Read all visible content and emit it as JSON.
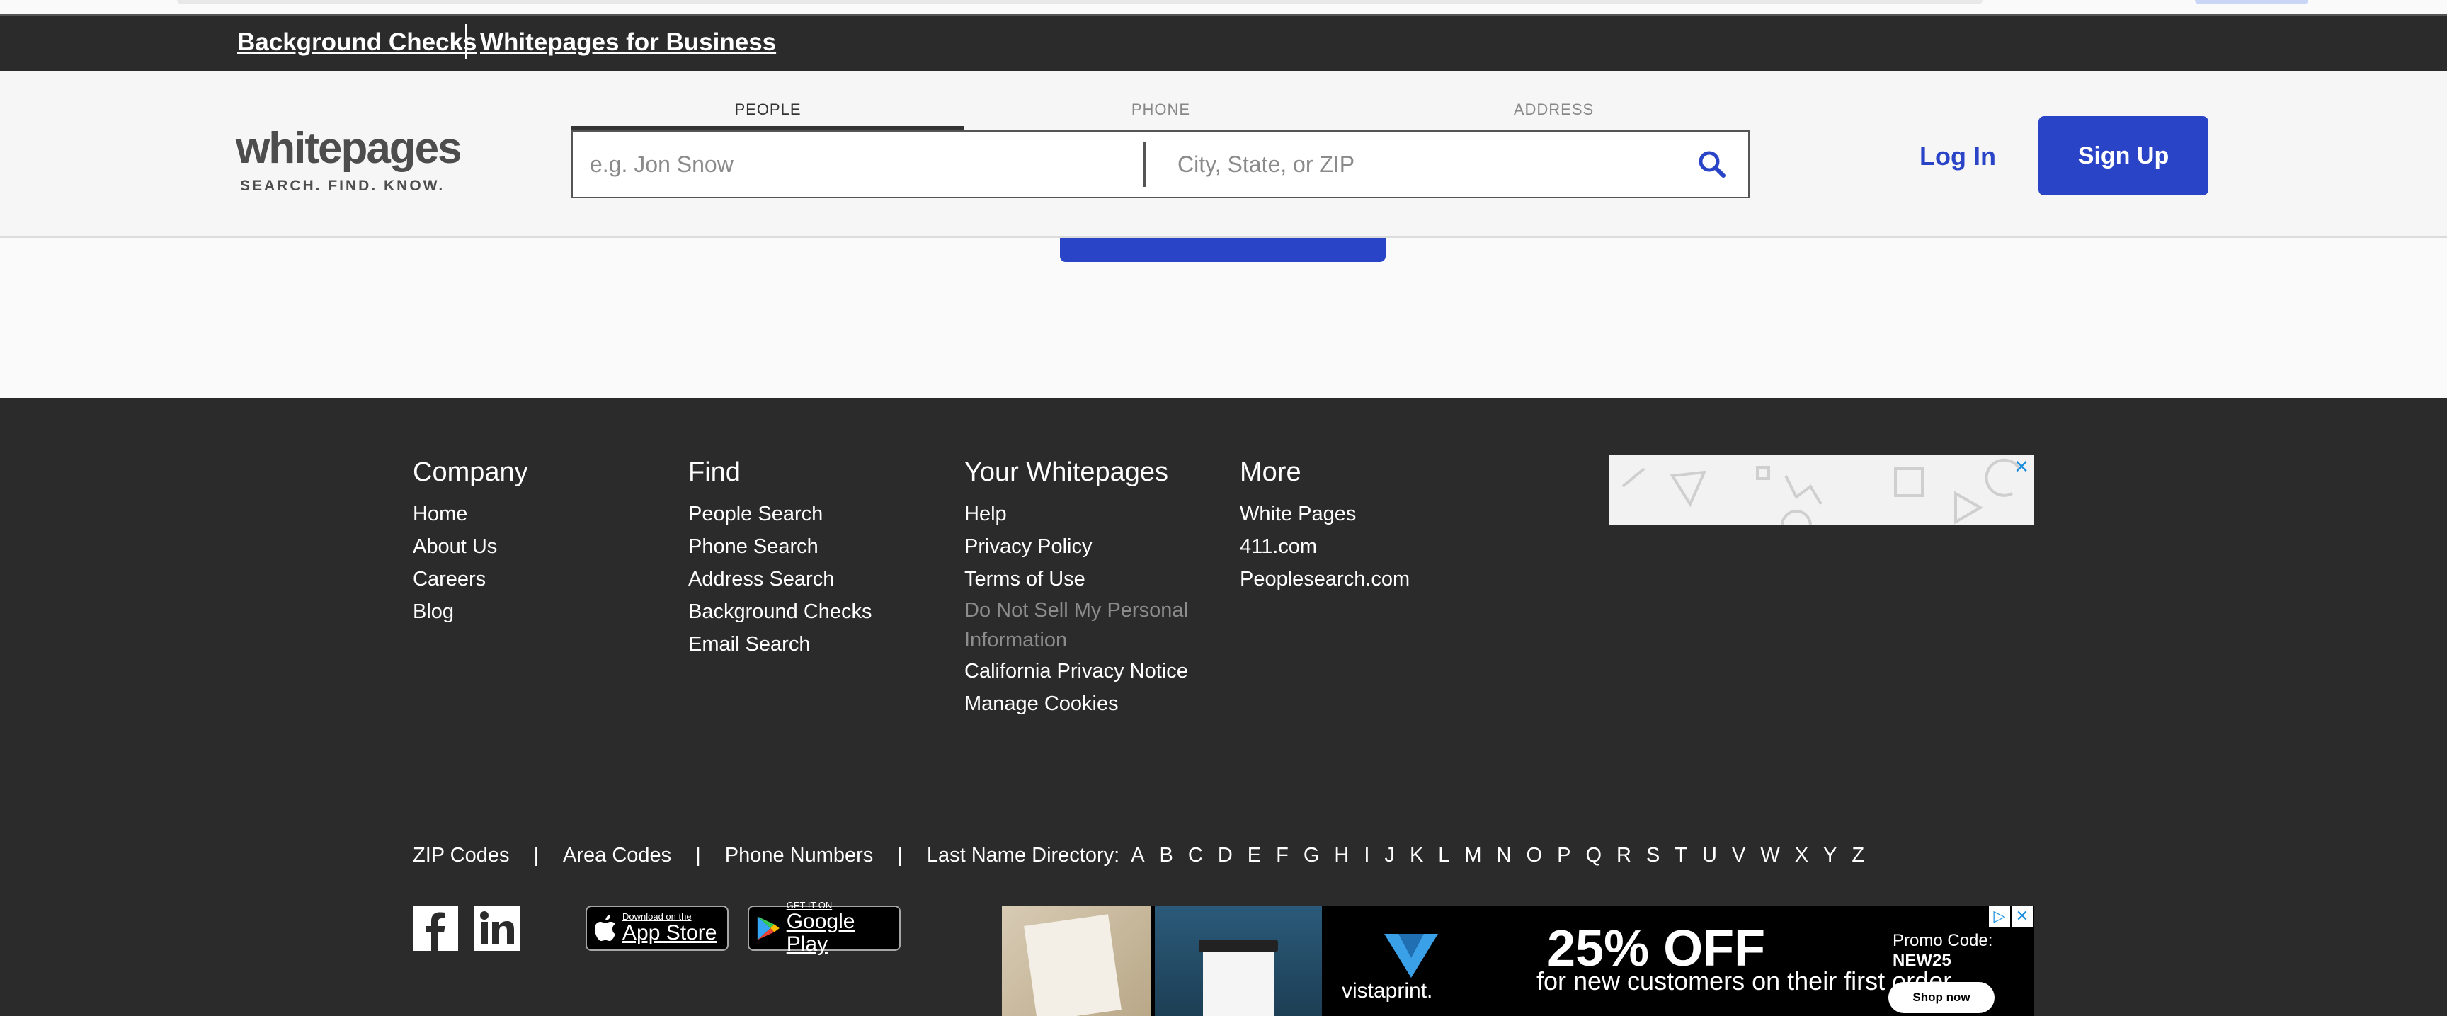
{
  "colors": {
    "brand_blue": "#2a44c7",
    "dark_bg": "#2b2b2b",
    "header_bg": "#f6f6f6",
    "muted_link": "#8c8c8c"
  },
  "topbar": {
    "link_background_checks": "Background Checks",
    "link_business": "Whitepages for Business"
  },
  "header": {
    "logo_word": "whitepages",
    "logo_tagline": "SEARCH. FIND. KNOW.",
    "tabs": [
      {
        "label": "PEOPLE",
        "active": true
      },
      {
        "label": "PHONE",
        "active": false
      },
      {
        "label": "ADDRESS",
        "active": false
      }
    ],
    "search": {
      "name_placeholder": "e.g. Jon Snow",
      "location_placeholder": "City, State, or ZIP",
      "icon": "search-icon"
    },
    "login_label": "Log In",
    "signup_label": "Sign Up"
  },
  "footer": {
    "columns": [
      {
        "title": "Company",
        "links": [
          "Home",
          "About Us",
          "Careers",
          "Blog"
        ]
      },
      {
        "title": "Find",
        "links": [
          "People Search",
          "Phone Search",
          "Address Search",
          "Background Checks",
          "Email Search"
        ]
      },
      {
        "title": "Your Whitepages",
        "links": [
          "Help",
          "Privacy Policy",
          "Terms of Use",
          "Do Not Sell My Personal Information",
          "California Privacy Notice",
          "Manage Cookies"
        ]
      },
      {
        "title": "More",
        "links": [
          "White Pages",
          "411.com",
          "Peoplesearch.com"
        ]
      }
    ],
    "directory": {
      "zip_codes": "ZIP Codes",
      "area_codes": "Area Codes",
      "phone_numbers": "Phone Numbers",
      "separator": "|",
      "last_name_label": "Last Name Directory:",
      "letters": [
        "A",
        "B",
        "C",
        "D",
        "E",
        "F",
        "G",
        "H",
        "I",
        "J",
        "K",
        "L",
        "M",
        "N",
        "O",
        "P",
        "Q",
        "R",
        "S",
        "T",
        "U",
        "V",
        "W",
        "X",
        "Y",
        "Z"
      ]
    },
    "social": {
      "facebook_icon": "facebook-icon",
      "linkedin_icon": "linkedin-icon"
    },
    "app_store": {
      "small": "Download on the",
      "big": "App Store"
    },
    "google_play": {
      "small": "GET IT ON",
      "big": "Google Play"
    },
    "ad_bottom": {
      "headline": "25% OFF",
      "subline": "for new customers on their first order",
      "promo_label": "Promo Code:",
      "promo_code": "NEW25",
      "cta": "Shop now",
      "brand": "vistaprint."
    },
    "ad_close": "✕"
  }
}
